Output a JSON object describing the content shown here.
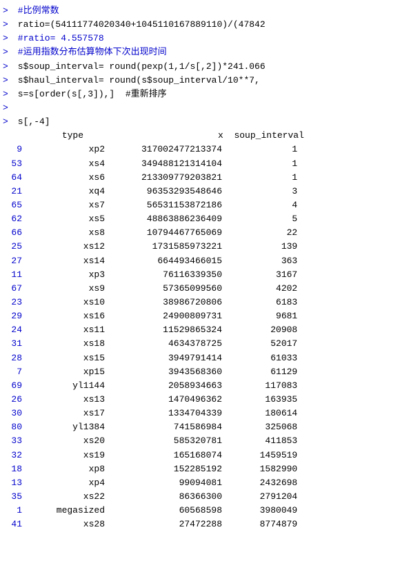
{
  "console": {
    "lines": [
      {
        "type": "comment",
        "prompt": ">",
        "content": " #比例常数"
      },
      {
        "type": "code",
        "prompt": ">",
        "content": " ratio=(54111774020340+1045110167889110)/(47842"
      },
      {
        "type": "comment",
        "prompt": ">",
        "content": " #ratio= 4.557578"
      },
      {
        "type": "comment",
        "prompt": ">",
        "content": " #运用指数分布估算物体下次出现时间"
      },
      {
        "type": "code",
        "prompt": ">",
        "content": " s$soup_interval= round(pexp(1,1/s[,2])*241.066"
      },
      {
        "type": "code",
        "prompt": ">",
        "content": " s$haul_interval= round(s$soup_interval/10**7,"
      },
      {
        "type": "code",
        "prompt": ">",
        "content": " s=s[order(s[,3]),]  #重新排序"
      },
      {
        "type": "blank"
      },
      {
        "type": "code",
        "prompt": ">",
        "content": " s[,-4]"
      }
    ],
    "table": {
      "header": "           type               x  soup_interval",
      "rows": [
        {
          "num": "9",
          "type": "xp2",
          "x": "317002477213374",
          "soup_interval": "1"
        },
        {
          "num": "53",
          "type": "xs4",
          "x": "349488121314104",
          "soup_interval": "1"
        },
        {
          "num": "64",
          "type": "xs6",
          "x": "213309779203821",
          "soup_interval": "1"
        },
        {
          "num": "21",
          "type": "xq4",
          "x": "96353293548646",
          "soup_interval": "3"
        },
        {
          "num": "65",
          "type": "xs7",
          "x": "56531153872186",
          "soup_interval": "4"
        },
        {
          "num": "62",
          "type": "xs5",
          "x": "48863886236409",
          "soup_interval": "5"
        },
        {
          "num": "66",
          "type": "xs8",
          "x": "10794467765069",
          "soup_interval": "22"
        },
        {
          "num": "25",
          "type": "xs12",
          "x": "1731585973221",
          "soup_interval": "139"
        },
        {
          "num": "27",
          "type": "xs14",
          "x": "664493466015",
          "soup_interval": "363"
        },
        {
          "num": "11",
          "type": "xp3",
          "x": "76116339350",
          "soup_interval": "3167"
        },
        {
          "num": "67",
          "type": "xs9",
          "x": "57365099560",
          "soup_interval": "4202"
        },
        {
          "num": "23",
          "type": "xs10",
          "x": "38986720806",
          "soup_interval": "6183"
        },
        {
          "num": "29",
          "type": "xs16",
          "x": "24900809731",
          "soup_interval": "9681"
        },
        {
          "num": "24",
          "type": "xs11",
          "x": "11529865324",
          "soup_interval": "20908"
        },
        {
          "num": "31",
          "type": "xs18",
          "x": "4634378725",
          "soup_interval": "52017"
        },
        {
          "num": "28",
          "type": "xs15",
          "x": "3949791414",
          "soup_interval": "61033"
        },
        {
          "num": "7",
          "type": "xp15",
          "x": "3943568360",
          "soup_interval": "61129"
        },
        {
          "num": "69",
          "type": "yl1144",
          "x": "2058934663",
          "soup_interval": "117083"
        },
        {
          "num": "26",
          "type": "xs13",
          "x": "1470496362",
          "soup_interval": "163935"
        },
        {
          "num": "30",
          "type": "xs17",
          "x": "1334704339",
          "soup_interval": "180614"
        },
        {
          "num": "80",
          "type": "yl1384",
          "x": "741586984",
          "soup_interval": "325068"
        },
        {
          "num": "33",
          "type": "xs20",
          "x": "585320781",
          "soup_interval": "411853"
        },
        {
          "num": "32",
          "type": "xs19",
          "x": "165168074",
          "soup_interval": "1459519"
        },
        {
          "num": "18",
          "type": "xp8",
          "x": "152285192",
          "soup_interval": "1582990"
        },
        {
          "num": "13",
          "type": "xp4",
          "x": "99094081",
          "soup_interval": "2432698"
        },
        {
          "num": "35",
          "type": "xs22",
          "x": "86366300",
          "soup_interval": "2791204"
        },
        {
          "num": "1",
          "type": "megasized",
          "x": "60568598",
          "soup_interval": "3980049"
        },
        {
          "num": "41",
          "type": "xs28",
          "x": "27472288",
          "soup_interval": "8774879"
        }
      ]
    }
  }
}
